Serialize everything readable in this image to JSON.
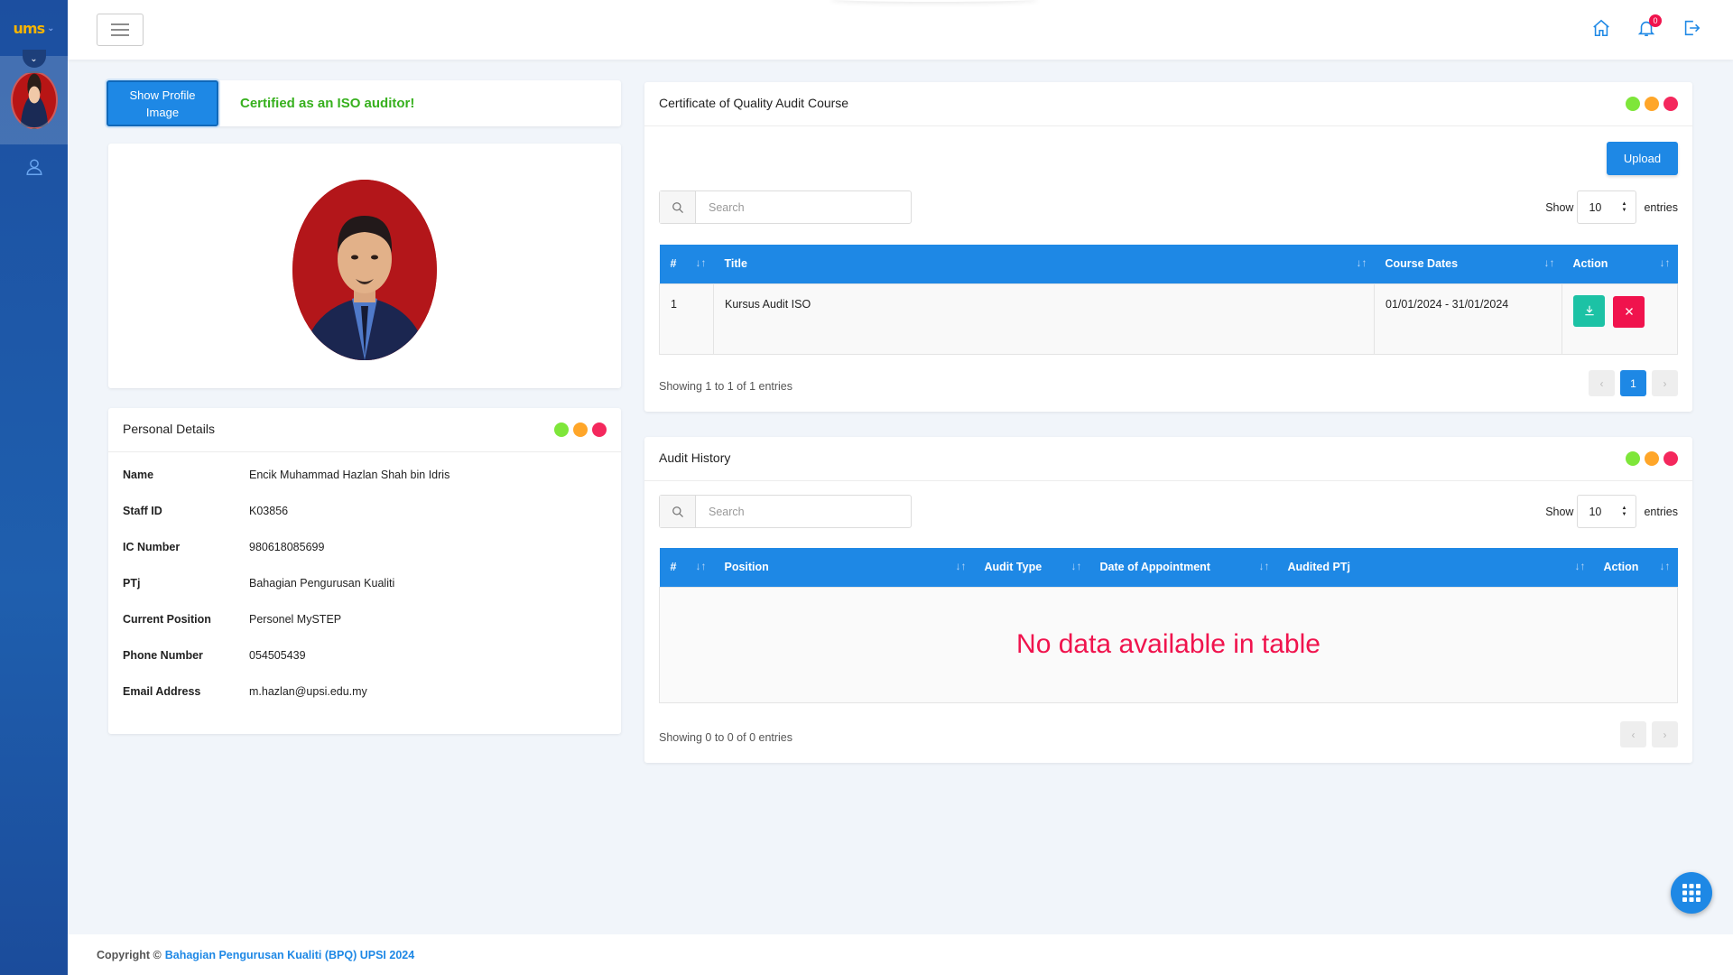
{
  "sidebar": {
    "logo_text": "ums",
    "nav": [
      {
        "icon": "user-icon"
      }
    ]
  },
  "topbar": {
    "notification_count": "0"
  },
  "profile": {
    "show_image_label": "Show Profile Image",
    "certified_text": "Certified as an ISO auditor!"
  },
  "personal_details": {
    "title": "Personal Details",
    "fields": [
      {
        "label": "Name",
        "value": "Encik Muhammad Hazlan Shah bin Idris"
      },
      {
        "label": "Staff ID",
        "value": "K03856"
      },
      {
        "label": "IC Number",
        "value": "980618085699"
      },
      {
        "label": "PTj",
        "value": "Bahagian Pengurusan Kualiti"
      },
      {
        "label": "Current Position",
        "value": "Personel MySTEP"
      },
      {
        "label": "Phone Number",
        "value": "054505439"
      },
      {
        "label": "Email Address",
        "value": "m.hazlan@upsi.edu.my"
      }
    ]
  },
  "certificate": {
    "title": "Certificate of Quality Audit Course",
    "upload_label": "Upload",
    "search_placeholder": "Search",
    "show_label": "Show",
    "entries_value": "10",
    "entries_label": "entries",
    "columns": [
      "#",
      "Title",
      "Course Dates",
      "Action"
    ],
    "rows": [
      {
        "no": "1",
        "title": "Kursus Audit ISO",
        "dates": "01/01/2024 - 31/01/2024"
      }
    ],
    "showing_text": "Showing 1 to 1 of 1 entries",
    "current_page": "1"
  },
  "audit_history": {
    "title": "Audit History",
    "search_placeholder": "Search",
    "show_label": "Show",
    "entries_value": "10",
    "entries_label": "entries",
    "columns": [
      "#",
      "Position",
      "Audit Type",
      "Date of Appointment",
      "Audited PTj",
      "Action"
    ],
    "empty_text": "No data available in table",
    "showing_text": "Showing 0 to 0 of 0 entries"
  },
  "footer": {
    "copyright": "Copyright ©",
    "org": "Bahagian Pengurusan Kualiti (BPQ) UPSI 2024"
  },
  "colors": {
    "primary": "#1e88e5",
    "success_text": "#37b01e",
    "danger": "#f0134d",
    "teal": "#1cc2a5"
  }
}
